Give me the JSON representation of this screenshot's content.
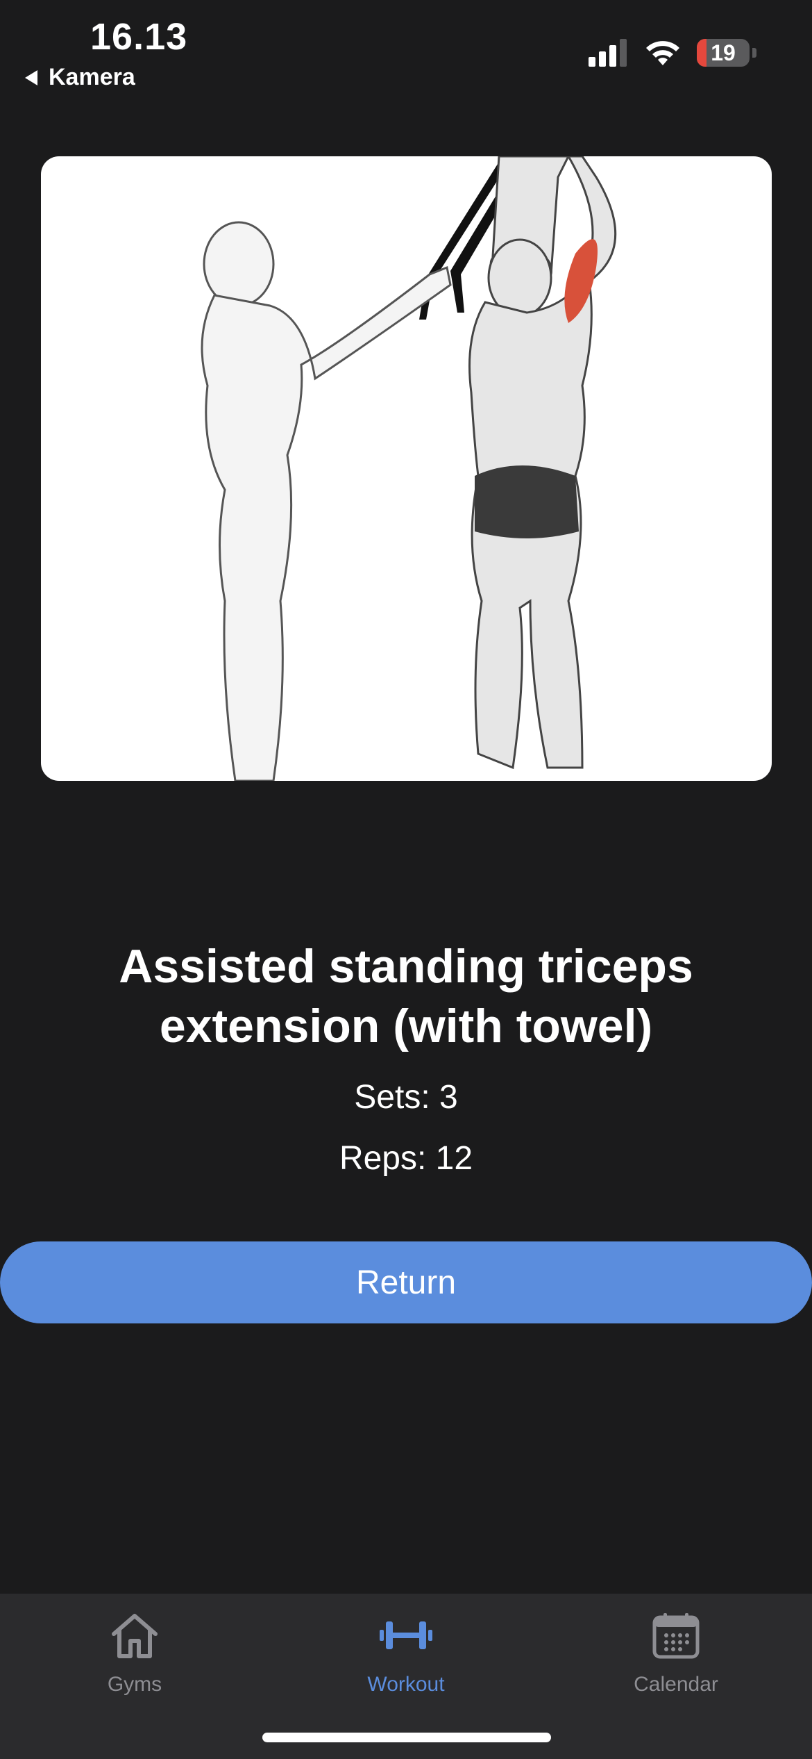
{
  "status_bar": {
    "time": "16.13",
    "back_app": "Kamera",
    "battery_level": "19",
    "signal_icon": "cellular-signal-icon",
    "wifi_icon": "wifi-icon"
  },
  "exercise": {
    "image_icon": "exercise-illustration",
    "name": "Assisted standing triceps extension (with towel)",
    "sets_text": "Sets: 3",
    "reps_text": "Reps: 12"
  },
  "actions": {
    "return_label": "Return"
  },
  "tabbar": {
    "items": [
      {
        "label": "Gyms",
        "icon": "house-icon",
        "active": false
      },
      {
        "label": "Workout",
        "icon": "dumbbell-icon",
        "active": true
      },
      {
        "label": "Calendar",
        "icon": "calendar-icon",
        "active": false
      }
    ]
  },
  "colors": {
    "background": "#1b1b1c",
    "accent": "#5b8ddd",
    "tabbar": "#2b2b2d",
    "inactive": "#8e8e93",
    "battery_low": "#e5483d"
  }
}
